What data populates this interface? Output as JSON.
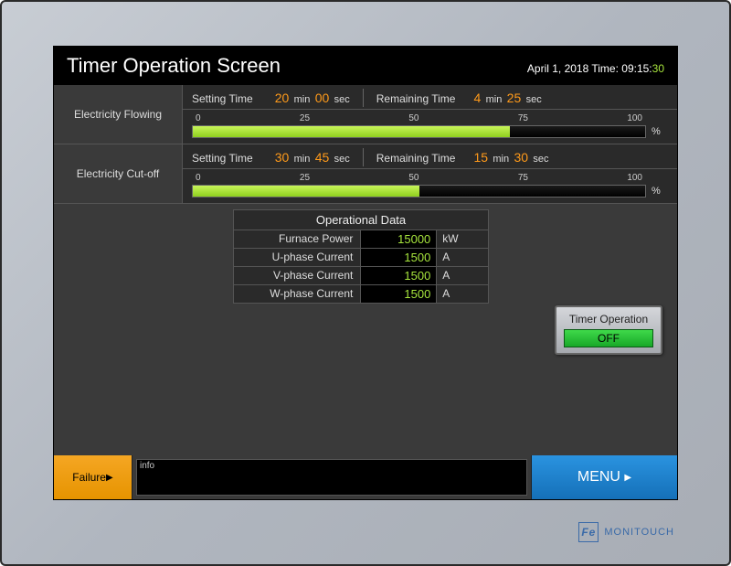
{
  "header": {
    "title": "Timer Operation Screen",
    "date": "April 1, 2018 Time: 09:15:",
    "seconds": "30"
  },
  "timers": {
    "flowing": {
      "label": "Electricity Flowing",
      "setting_label": "Setting Time",
      "set_min": "20",
      "set_min_u": "min",
      "set_sec": "00",
      "set_sec_u": "sec",
      "remain_label": "Remaining Time",
      "rem_min": "4",
      "rem_min_u": "min",
      "rem_sec": "25",
      "rem_sec_u": "sec",
      "ticks": [
        "0",
        "25",
        "50",
        "75",
        "100"
      ],
      "percent": 70,
      "pct_label": "%"
    },
    "cutoff": {
      "label": "Electricity Cut-off",
      "setting_label": "Setting Time",
      "set_min": "30",
      "set_min_u": "min",
      "set_sec": "45",
      "set_sec_u": "sec",
      "remain_label": "Remaining Time",
      "rem_min": "15",
      "rem_min_u": "min",
      "rem_sec": "30",
      "rem_sec_u": "sec",
      "ticks": [
        "0",
        "25",
        "50",
        "75",
        "100"
      ],
      "percent": 50,
      "pct_label": "%"
    }
  },
  "opdata": {
    "title": "Operational Data",
    "rows": [
      {
        "label": "Furnace Power",
        "value": "15000",
        "unit": "kW"
      },
      {
        "label": "U-phase Current",
        "value": "1500",
        "unit": "A"
      },
      {
        "label": "V-phase Current",
        "value": "1500",
        "unit": "A"
      },
      {
        "label": "W-phase Current",
        "value": "1500",
        "unit": "A"
      }
    ]
  },
  "timer_op_btn": {
    "label": "Timer Operation",
    "state": "OFF"
  },
  "footer": {
    "failure": "Failure",
    "info_label": "info",
    "menu": "MENU"
  },
  "brand": {
    "logo": "Fe",
    "name": "MONITOUCH"
  },
  "colors": {
    "accent_green": "#a8e63d",
    "accent_orange": "#ff9a1a",
    "menu_blue": "#1e88d8",
    "failure_orange": "#f5a623"
  }
}
